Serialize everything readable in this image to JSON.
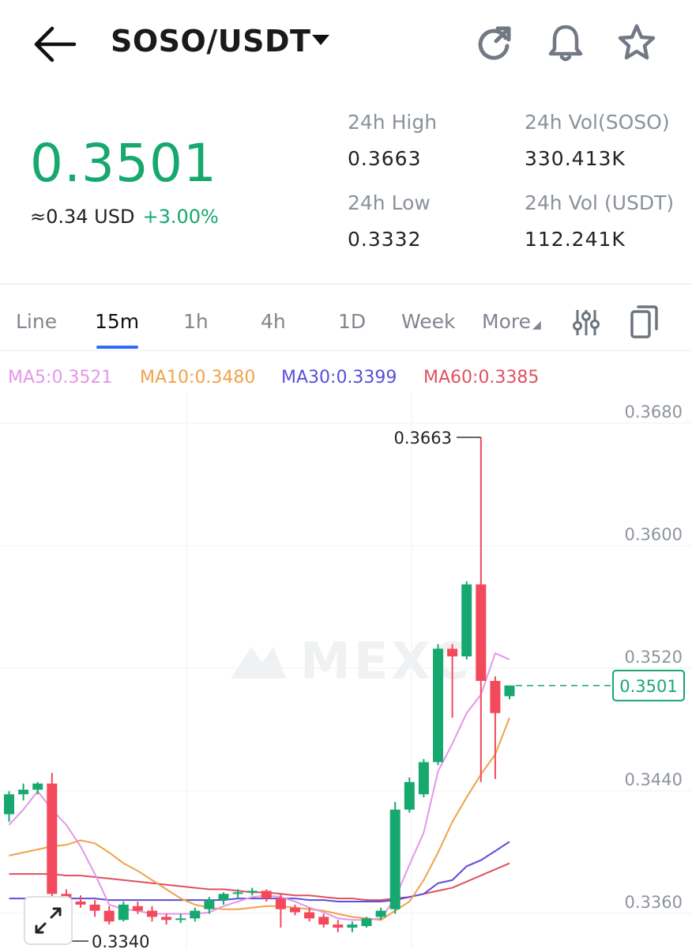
{
  "header": {
    "pair": "SOSO/USDT",
    "icons": [
      "back-arrow-icon",
      "caret-down-icon",
      "refresh-icon",
      "bell-icon",
      "star-icon"
    ]
  },
  "ticker": {
    "price": "0.3501",
    "approx_usd": "≈0.34 USD",
    "change": "+3.00%",
    "high_label": "24h High",
    "high_value": "0.3663",
    "low_label": "24h Low",
    "low_value": "0.3332",
    "vol_base_label": "24h Vol(SOSO)",
    "vol_base_value": "330.413K",
    "vol_quote_label": "24h Vol (USDT)",
    "vol_quote_value": "112.241K"
  },
  "tabs": [
    "Line",
    "15m",
    "1h",
    "4h",
    "1D",
    "Week",
    "More"
  ],
  "active_tab": "15m",
  "ma": {
    "ma5": "MA5:0.3521",
    "ma10": "MA10:0.3480",
    "ma30": "MA30:0.3399",
    "ma60": "MA60:0.3385"
  },
  "colors": {
    "up": "#17a870",
    "down": "#f2495c",
    "ma5": "#e596e8",
    "ma10": "#f0a24a",
    "ma30": "#5b4ed8",
    "ma60": "#e0515e",
    "accent": "#2d6cf6"
  },
  "chart_data": {
    "type": "candlestick",
    "watermark": "MEXC",
    "y_ticks": [
      "0.3680",
      "0.3600",
      "0.3520",
      "0.3440",
      "0.3360"
    ],
    "ylim": [
      0.3325,
      0.369
    ],
    "max_label": "0.3663",
    "min_label": "0.3340",
    "current_price_label": "0.3501",
    "current_price": 0.3501,
    "candles": [
      {
        "o": 0.3417,
        "h": 0.3432,
        "l": 0.3412,
        "c": 0.343
      },
      {
        "o": 0.343,
        "h": 0.3437,
        "l": 0.3426,
        "c": 0.3433
      },
      {
        "o": 0.3433,
        "h": 0.3438,
        "l": 0.343,
        "c": 0.3437
      },
      {
        "o": 0.3437,
        "h": 0.3444,
        "l": 0.3356,
        "c": 0.3365
      },
      {
        "o": 0.3365,
        "h": 0.3368,
        "l": 0.3358,
        "c": 0.3361
      },
      {
        "o": 0.336,
        "h": 0.3364,
        "l": 0.3356,
        "c": 0.3358
      },
      {
        "o": 0.3358,
        "h": 0.3361,
        "l": 0.335,
        "c": 0.3354
      },
      {
        "o": 0.3354,
        "h": 0.3357,
        "l": 0.3345,
        "c": 0.3347
      },
      {
        "o": 0.3348,
        "h": 0.336,
        "l": 0.3347,
        "c": 0.3358
      },
      {
        "o": 0.3357,
        "h": 0.336,
        "l": 0.3352,
        "c": 0.3354
      },
      {
        "o": 0.3354,
        "h": 0.3357,
        "l": 0.3347,
        "c": 0.335
      },
      {
        "o": 0.335,
        "h": 0.3352,
        "l": 0.3345,
        "c": 0.3348
      },
      {
        "o": 0.3348,
        "h": 0.3352,
        "l": 0.3346,
        "c": 0.3349
      },
      {
        "o": 0.3349,
        "h": 0.3356,
        "l": 0.3347,
        "c": 0.3354
      },
      {
        "o": 0.3355,
        "h": 0.3363,
        "l": 0.3352,
        "c": 0.3361
      },
      {
        "o": 0.3361,
        "h": 0.3366,
        "l": 0.3358,
        "c": 0.3365
      },
      {
        "o": 0.3365,
        "h": 0.3368,
        "l": 0.3362,
        "c": 0.3366
      },
      {
        "o": 0.3366,
        "h": 0.3369,
        "l": 0.3364,
        "c": 0.3367
      },
      {
        "o": 0.3367,
        "h": 0.3368,
        "l": 0.336,
        "c": 0.3362
      },
      {
        "o": 0.3362,
        "h": 0.3365,
        "l": 0.3343,
        "c": 0.3355
      },
      {
        "o": 0.3356,
        "h": 0.3358,
        "l": 0.3351,
        "c": 0.3353
      },
      {
        "o": 0.3353,
        "h": 0.3356,
        "l": 0.3347,
        "c": 0.3349
      },
      {
        "o": 0.335,
        "h": 0.3352,
        "l": 0.3343,
        "c": 0.3345
      },
      {
        "o": 0.3345,
        "h": 0.3348,
        "l": 0.334,
        "c": 0.3343
      },
      {
        "o": 0.3343,
        "h": 0.3347,
        "l": 0.334,
        "c": 0.3345
      },
      {
        "o": 0.3344,
        "h": 0.335,
        "l": 0.3343,
        "c": 0.3349
      },
      {
        "o": 0.335,
        "h": 0.3356,
        "l": 0.3348,
        "c": 0.3354
      },
      {
        "o": 0.3355,
        "h": 0.3425,
        "l": 0.3352,
        "c": 0.342
      },
      {
        "o": 0.342,
        "h": 0.3441,
        "l": 0.3418,
        "c": 0.3438
      },
      {
        "o": 0.343,
        "h": 0.3453,
        "l": 0.3428,
        "c": 0.3451
      },
      {
        "o": 0.3451,
        "h": 0.3528,
        "l": 0.3449,
        "c": 0.3525
      },
      {
        "o": 0.3525,
        "h": 0.3528,
        "l": 0.348,
        "c": 0.352
      },
      {
        "o": 0.352,
        "h": 0.3569,
        "l": 0.3518,
        "c": 0.3567
      },
      {
        "o": 0.3567,
        "h": 0.3663,
        "l": 0.3438,
        "c": 0.3504
      },
      {
        "o": 0.3504,
        "h": 0.3507,
        "l": 0.344,
        "c": 0.3483
      },
      {
        "o": 0.3494,
        "h": 0.3501,
        "l": 0.3492,
        "c": 0.3501
      }
    ],
    "ma5_values": [
      0.341,
      0.342,
      0.3432,
      0.342,
      0.341,
      0.3396,
      0.3378,
      0.3358,
      0.3355,
      0.3354,
      0.3352,
      0.3352,
      0.3352,
      0.3352,
      0.3353,
      0.3357,
      0.336,
      0.3363,
      0.3364,
      0.3363,
      0.336,
      0.3356,
      0.3353,
      0.3349,
      0.3348,
      0.3348,
      0.3349,
      0.3362,
      0.3384,
      0.3405,
      0.3445,
      0.3463,
      0.3483,
      0.3495,
      0.3522,
      0.3518
    ],
    "ma10_values": [
      0.339,
      0.3392,
      0.3394,
      0.3396,
      0.3397,
      0.34,
      0.3398,
      0.3392,
      0.3385,
      0.338,
      0.3374,
      0.3368,
      0.3362,
      0.3358,
      0.3356,
      0.3355,
      0.3355,
      0.3356,
      0.3357,
      0.3357,
      0.3356,
      0.3355,
      0.3354,
      0.3352,
      0.335,
      0.3349,
      0.3348,
      0.3354,
      0.336,
      0.3374,
      0.3392,
      0.3412,
      0.3428,
      0.3443,
      0.3456,
      0.348
    ],
    "ma30_values": [
      0.3362,
      0.3362,
      0.3362,
      0.3362,
      0.3362,
      0.3362,
      0.3362,
      0.3361,
      0.3361,
      0.3361,
      0.3361,
      0.3361,
      0.3361,
      0.3361,
      0.3361,
      0.3361,
      0.3362,
      0.3362,
      0.3362,
      0.3362,
      0.3362,
      0.3361,
      0.3361,
      0.336,
      0.336,
      0.336,
      0.336,
      0.3361,
      0.3363,
      0.3365,
      0.3372,
      0.3374,
      0.3383,
      0.3387,
      0.3393,
      0.3399
    ],
    "ma60_values": [
      0.3378,
      0.3378,
      0.3378,
      0.3378,
      0.3377,
      0.3377,
      0.3376,
      0.3375,
      0.3374,
      0.3373,
      0.3372,
      0.3371,
      0.337,
      0.3369,
      0.3368,
      0.3368,
      0.3367,
      0.3366,
      0.3366,
      0.3365,
      0.3364,
      0.3364,
      0.3363,
      0.3362,
      0.3362,
      0.3361,
      0.3361,
      0.3362,
      0.3363,
      0.3365,
      0.3367,
      0.3369,
      0.3373,
      0.3377,
      0.3381,
      0.3385
    ]
  }
}
